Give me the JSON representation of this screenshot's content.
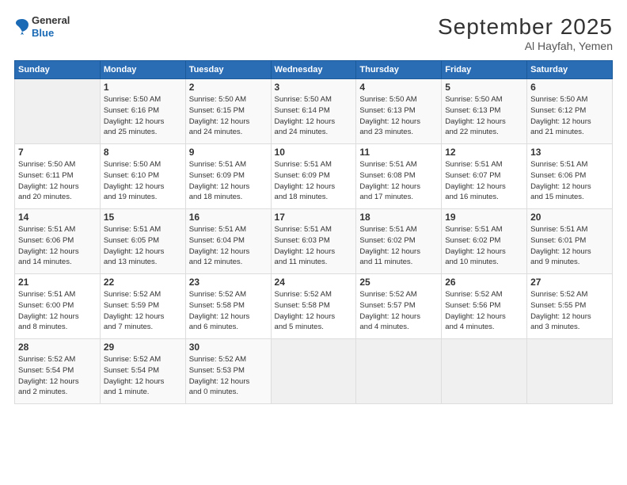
{
  "header": {
    "logo_general": "General",
    "logo_blue": "Blue",
    "month_title": "September 2025",
    "location": "Al Hayfah, Yemen"
  },
  "calendar": {
    "weekdays": [
      "Sunday",
      "Monday",
      "Tuesday",
      "Wednesday",
      "Thursday",
      "Friday",
      "Saturday"
    ],
    "weeks": [
      [
        {
          "day": "",
          "info": ""
        },
        {
          "day": "1",
          "info": "Sunrise: 5:50 AM\nSunset: 6:16 PM\nDaylight: 12 hours\nand 25 minutes."
        },
        {
          "day": "2",
          "info": "Sunrise: 5:50 AM\nSunset: 6:15 PM\nDaylight: 12 hours\nand 24 minutes."
        },
        {
          "day": "3",
          "info": "Sunrise: 5:50 AM\nSunset: 6:14 PM\nDaylight: 12 hours\nand 24 minutes."
        },
        {
          "day": "4",
          "info": "Sunrise: 5:50 AM\nSunset: 6:13 PM\nDaylight: 12 hours\nand 23 minutes."
        },
        {
          "day": "5",
          "info": "Sunrise: 5:50 AM\nSunset: 6:13 PM\nDaylight: 12 hours\nand 22 minutes."
        },
        {
          "day": "6",
          "info": "Sunrise: 5:50 AM\nSunset: 6:12 PM\nDaylight: 12 hours\nand 21 minutes."
        }
      ],
      [
        {
          "day": "7",
          "info": "Sunrise: 5:50 AM\nSunset: 6:11 PM\nDaylight: 12 hours\nand 20 minutes."
        },
        {
          "day": "8",
          "info": "Sunrise: 5:50 AM\nSunset: 6:10 PM\nDaylight: 12 hours\nand 19 minutes."
        },
        {
          "day": "9",
          "info": "Sunrise: 5:51 AM\nSunset: 6:09 PM\nDaylight: 12 hours\nand 18 minutes."
        },
        {
          "day": "10",
          "info": "Sunrise: 5:51 AM\nSunset: 6:09 PM\nDaylight: 12 hours\nand 18 minutes."
        },
        {
          "day": "11",
          "info": "Sunrise: 5:51 AM\nSunset: 6:08 PM\nDaylight: 12 hours\nand 17 minutes."
        },
        {
          "day": "12",
          "info": "Sunrise: 5:51 AM\nSunset: 6:07 PM\nDaylight: 12 hours\nand 16 minutes."
        },
        {
          "day": "13",
          "info": "Sunrise: 5:51 AM\nSunset: 6:06 PM\nDaylight: 12 hours\nand 15 minutes."
        }
      ],
      [
        {
          "day": "14",
          "info": "Sunrise: 5:51 AM\nSunset: 6:06 PM\nDaylight: 12 hours\nand 14 minutes."
        },
        {
          "day": "15",
          "info": "Sunrise: 5:51 AM\nSunset: 6:05 PM\nDaylight: 12 hours\nand 13 minutes."
        },
        {
          "day": "16",
          "info": "Sunrise: 5:51 AM\nSunset: 6:04 PM\nDaylight: 12 hours\nand 12 minutes."
        },
        {
          "day": "17",
          "info": "Sunrise: 5:51 AM\nSunset: 6:03 PM\nDaylight: 12 hours\nand 11 minutes."
        },
        {
          "day": "18",
          "info": "Sunrise: 5:51 AM\nSunset: 6:02 PM\nDaylight: 12 hours\nand 11 minutes."
        },
        {
          "day": "19",
          "info": "Sunrise: 5:51 AM\nSunset: 6:02 PM\nDaylight: 12 hours\nand 10 minutes."
        },
        {
          "day": "20",
          "info": "Sunrise: 5:51 AM\nSunset: 6:01 PM\nDaylight: 12 hours\nand 9 minutes."
        }
      ],
      [
        {
          "day": "21",
          "info": "Sunrise: 5:51 AM\nSunset: 6:00 PM\nDaylight: 12 hours\nand 8 minutes."
        },
        {
          "day": "22",
          "info": "Sunrise: 5:52 AM\nSunset: 5:59 PM\nDaylight: 12 hours\nand 7 minutes."
        },
        {
          "day": "23",
          "info": "Sunrise: 5:52 AM\nSunset: 5:58 PM\nDaylight: 12 hours\nand 6 minutes."
        },
        {
          "day": "24",
          "info": "Sunrise: 5:52 AM\nSunset: 5:58 PM\nDaylight: 12 hours\nand 5 minutes."
        },
        {
          "day": "25",
          "info": "Sunrise: 5:52 AM\nSunset: 5:57 PM\nDaylight: 12 hours\nand 4 minutes."
        },
        {
          "day": "26",
          "info": "Sunrise: 5:52 AM\nSunset: 5:56 PM\nDaylight: 12 hours\nand 4 minutes."
        },
        {
          "day": "27",
          "info": "Sunrise: 5:52 AM\nSunset: 5:55 PM\nDaylight: 12 hours\nand 3 minutes."
        }
      ],
      [
        {
          "day": "28",
          "info": "Sunrise: 5:52 AM\nSunset: 5:54 PM\nDaylight: 12 hours\nand 2 minutes."
        },
        {
          "day": "29",
          "info": "Sunrise: 5:52 AM\nSunset: 5:54 PM\nDaylight: 12 hours\nand 1 minute."
        },
        {
          "day": "30",
          "info": "Sunrise: 5:52 AM\nSunset: 5:53 PM\nDaylight: 12 hours\nand 0 minutes."
        },
        {
          "day": "",
          "info": ""
        },
        {
          "day": "",
          "info": ""
        },
        {
          "day": "",
          "info": ""
        },
        {
          "day": "",
          "info": ""
        }
      ]
    ]
  }
}
